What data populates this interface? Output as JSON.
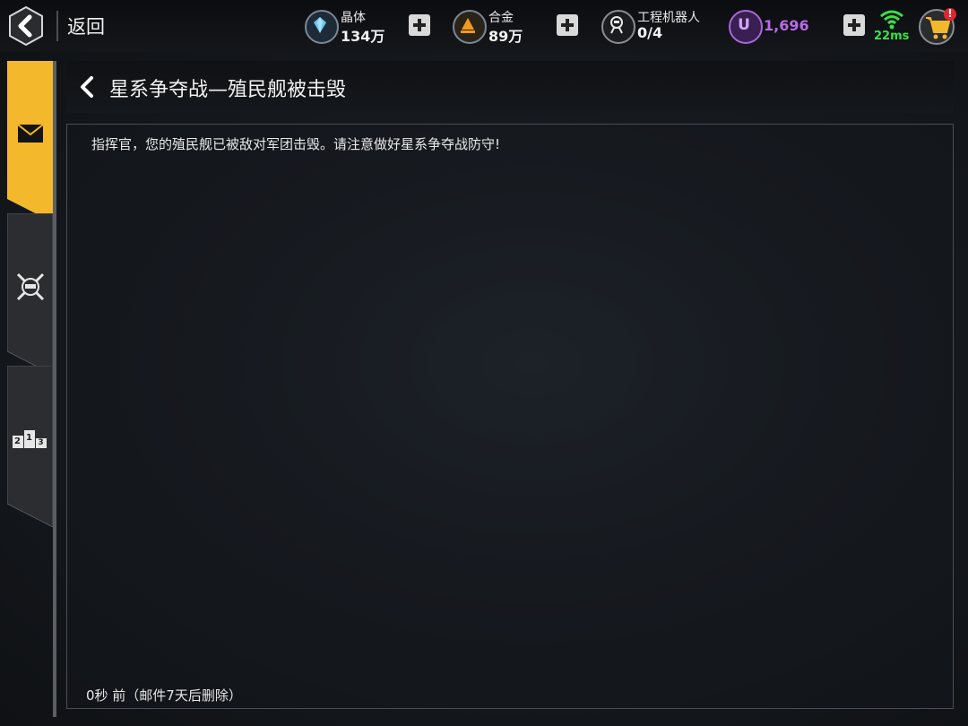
{
  "topbar": {
    "back_label": "返回",
    "crystal": {
      "name": "晶体",
      "value": "134万"
    },
    "alloy": {
      "name": "合金",
      "value": "89万"
    },
    "robots": {
      "name": "工程机器人",
      "value": "0/4"
    },
    "coin": {
      "icon_letter": "U",
      "value": "1,696"
    },
    "ping": "22ms",
    "cart_badge": "!"
  },
  "tabs": [
    {
      "name": "mail",
      "icon": "envelope-icon",
      "active": true
    },
    {
      "name": "battle",
      "icon": "crossed-swords-icon",
      "active": false
    },
    {
      "name": "ranking",
      "icon": "podium-icon",
      "active": false,
      "podium": [
        "2",
        "1",
        "3"
      ]
    }
  ],
  "mail": {
    "title": "星系争夺战—殖民舰被击毁",
    "body": "指挥官，您的殖民舰已被敌对军团击毁。请注意做好星系争夺战防守!",
    "footer": "0秒 前（邮件7天后删除）"
  },
  "colors": {
    "accent_yellow": "#f4b82c",
    "coin_purple": "#b86be8",
    "ping_green": "#38e04a"
  }
}
